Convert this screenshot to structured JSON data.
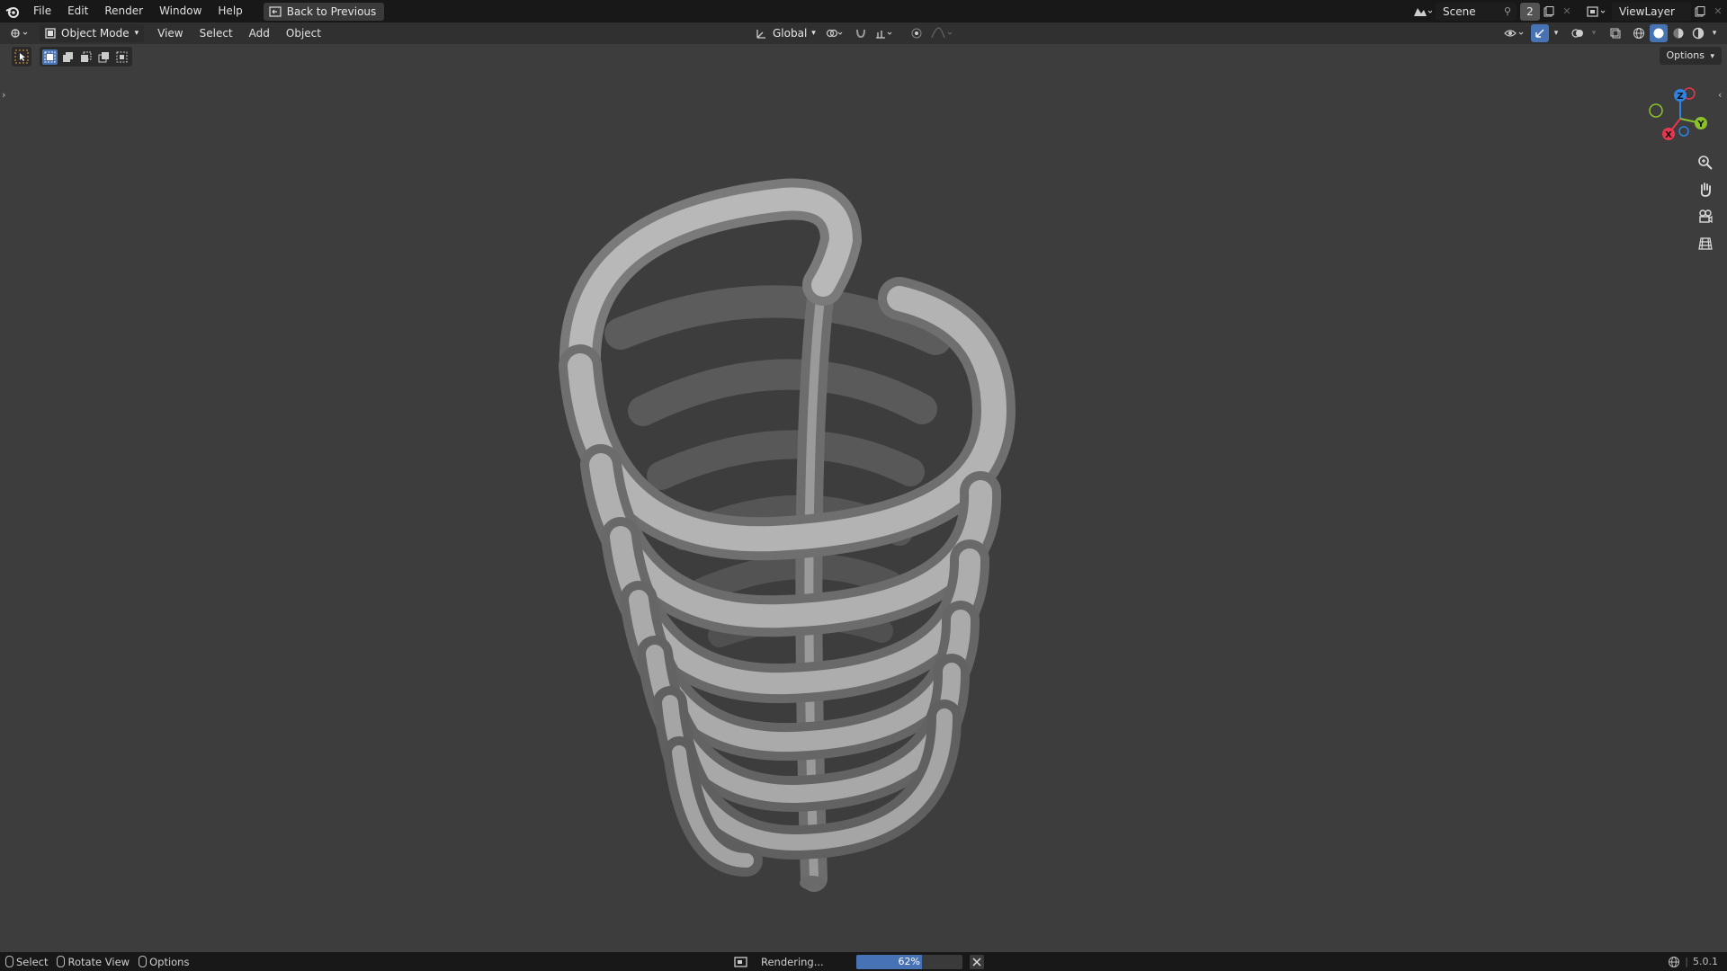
{
  "topbar": {
    "menus": [
      "File",
      "Edit",
      "Render",
      "Window",
      "Help"
    ],
    "back_button": "Back to Previous",
    "scene_name": "Scene",
    "scene_users": "2",
    "view_layer": "ViewLayer"
  },
  "header": {
    "mode": "Object Mode",
    "menus": [
      "View",
      "Select",
      "Add",
      "Object"
    ],
    "transform_orientation": "Global"
  },
  "toolbar": {
    "options_label": "Options"
  },
  "gizmo": {
    "axes": [
      "Z",
      "Y",
      "X"
    ],
    "colors": {
      "x": "#e5384f",
      "y": "#8bc22c",
      "z": "#2f83e3"
    }
  },
  "status": {
    "hints": [
      "Select",
      "Rotate View",
      "Options"
    ],
    "render_label": "Rendering...",
    "progress": 62,
    "progress_text": "62%",
    "version": "5.0.1"
  },
  "colors": {
    "accent": "#4772b3",
    "viewport_bg": "#3d3d3d"
  }
}
